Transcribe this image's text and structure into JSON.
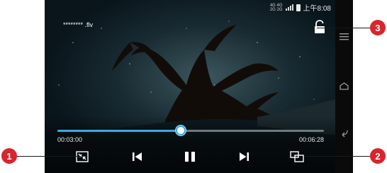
{
  "status_bar": {
    "network_top": "4G 4G",
    "network_bottom": "2G 2G",
    "time": "上午8:08"
  },
  "player": {
    "file_name": "******** .flv",
    "current_time": "00:03:00",
    "total_time": "00:06:28",
    "progress": 0.463
  },
  "callouts": [
    "1",
    "2",
    "3"
  ],
  "colors": {
    "progress": "#3aa9e0",
    "callout": "#d9252c"
  },
  "icons": {
    "lock": "lock-icon",
    "fullscreen": "exit-fullscreen-icon",
    "previous": "skip-previous-icon",
    "pause": "pause-icon",
    "next": "skip-next-icon",
    "pip": "picture-in-picture-icon",
    "menu": "menu-icon",
    "home": "home-icon",
    "back": "back-icon"
  }
}
